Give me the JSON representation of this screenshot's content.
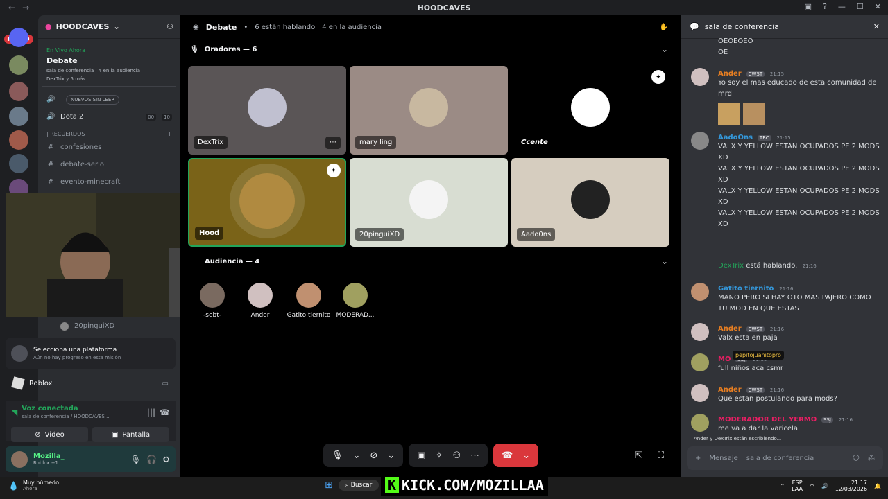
{
  "window": {
    "title": "HOODCAVES",
    "nav_back": "←",
    "nav_forward": "→"
  },
  "serverbar": {
    "new_badge": "NUEVO"
  },
  "server": {
    "name": "HOODCAVES"
  },
  "live": {
    "label": "En Vivo Ahora",
    "title": "Debate",
    "sub": "sala de conferencia · 4 en la audiencia",
    "users": "DexTrix y 5 más"
  },
  "channels": [
    {
      "icon": "🔊",
      "name": "",
      "pill": "NUEVOS SIN LEER"
    },
    {
      "icon": "🔊",
      "name": "Dota 2",
      "count_a": "00",
      "count_b": "10"
    }
  ],
  "category": {
    "name": "| RECUERDOS"
  },
  "text_channels": [
    "confesiones",
    "debate-serio",
    "evento-minecraft"
  ],
  "voice_member": "20pinguiXD",
  "platform": {
    "title": "Selecciona una plataforma",
    "sub": "Aún no hay progreso en esta misión"
  },
  "roblox": {
    "label": "Roblox"
  },
  "voice": {
    "status": "Voz conectada",
    "channel": "sala de conferencia / HOODCAVES ...",
    "video_label": "Video",
    "screen_label": "Pantalla"
  },
  "user": {
    "name": "Mozilla_",
    "status": "Roblox +1"
  },
  "stage": {
    "name": "Debate",
    "speaking": "6 están hablando",
    "audience": "4 en la audiencia",
    "speakers_title": "Oradores — 6",
    "audience_title": "Audiencia — 4"
  },
  "tiles": [
    {
      "name": "DexTrix",
      "bg": "#5a5556"
    },
    {
      "name": "mary ling",
      "bg": "#9b8b85"
    },
    {
      "name": "Ccente",
      "bg": "#000000"
    },
    {
      "name": "Hood",
      "bg": "#7a6318"
    },
    {
      "name": "20pinguiXD",
      "bg": "#d8ddd2"
    },
    {
      "name": "Aado0ns",
      "bg": "#d6cdbf"
    }
  ],
  "audience": [
    "-sebt-",
    "Ander",
    "Gatito tiernito",
    "MODERAD..."
  ],
  "chat": {
    "channel": "sala de conferencia",
    "top_lines": [
      "OEOEOEO",
      "OE"
    ],
    "messages": [
      {
        "name": "Ander",
        "color": "#e67e22",
        "tag": "CWST",
        "time": "21:15",
        "text": "Yo soy el mas educado de esta comunidad de mrd"
      },
      {
        "name": "AadoOns",
        "color": "#3498db",
        "tag": "TRC",
        "time": "21:15",
        "text": "VALX Y YELLOW ESTAN OCUPADOS PE 2 MODS XD"
      },
      {
        "name": "",
        "color": "",
        "tag": "",
        "time": "",
        "text": "VALX Y YELLOW ESTAN OCUPADOS PE 2 MODS XD"
      },
      {
        "name": "",
        "color": "",
        "tag": "",
        "time": "",
        "text": "VALX Y YELLOW ESTAN OCUPADOS PE 2 MODS XD"
      },
      {
        "name": "",
        "color": "",
        "tag": "",
        "time": "",
        "text": "VALX Y YELLOW ESTAN OCUPADOS PE 2 MODS XD"
      },
      {
        "name": "Gatito tiernito",
        "color": "#3498db",
        "tag": "",
        "time": "21:16",
        "text": "MANO PERO SI HAY OTO MAS PAJERO COMO TU MOD EN QUE ESTAS"
      },
      {
        "name": "Ander",
        "color": "#e67e22",
        "tag": "CWST",
        "time": "21:16",
        "text": "Valx esta en paja"
      },
      {
        "name": "MO",
        "color": "#e91e63",
        "tag": "SSJ",
        "time": "21:16",
        "text": "full niños aca csmr"
      },
      {
        "name": "Ander",
        "color": "#e67e22",
        "tag": "CWST",
        "time": "21:16",
        "text": "Que estan postulando para mods?"
      },
      {
        "name": "MODERADOR DEL YERMO",
        "color": "#e91e63",
        "tag": "SSJ",
        "time": "21:16",
        "text": "me va a dar la varicela"
      }
    ],
    "system": {
      "user": "DexTrix",
      "text": "está hablando.",
      "time": "21:16"
    },
    "typing": "Ander y DexTrix están escribiendo...",
    "popup": "pepitojuanitopro",
    "input_placeholder": "Mensaje",
    "input_channel": "sala de conferencia"
  },
  "taskbar": {
    "weather": "Muy húmedo",
    "weather_sub": "Ahora",
    "search": "Buscar",
    "lang": "ESP",
    "lang_sub": "LAA",
    "time": "21:17",
    "date": "12/03/2026"
  },
  "kick": {
    "k": "K",
    "text": "KICK.COM/MOZILLAA"
  }
}
